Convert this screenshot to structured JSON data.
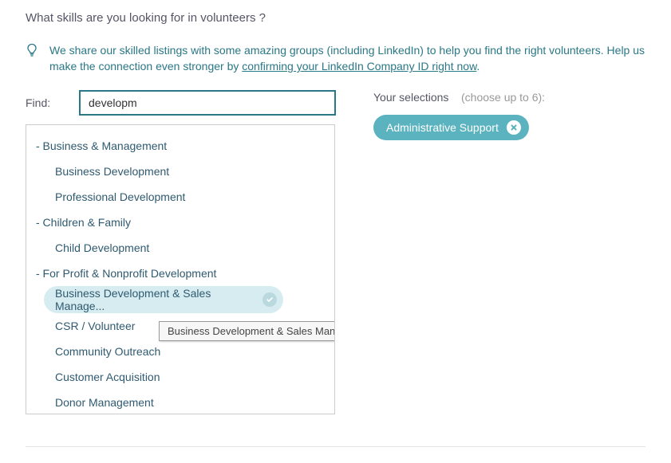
{
  "question": "What skills are you looking for in volunteers ?",
  "info": {
    "pre": "We share our skilled listings with some amazing groups (including LinkedIn) to help you find the right volunteers. Help us make the connection even stronger by ",
    "link": "confirming your LinkedIn Company ID right now",
    "post": "."
  },
  "find_label": "Find:",
  "find_value": "developm",
  "categories": [
    {
      "label": "- Business & Management",
      "items": [
        "Business Development",
        "Professional Development"
      ]
    },
    {
      "label": "- Children & Family",
      "items": [
        "Child Development"
      ]
    },
    {
      "label": "- For Profit & Nonprofit Development",
      "items": [
        "Business Development & Sales Manage...",
        "CSR / Volunteer Coordination",
        "Community Outreach",
        "Customer Acquisition",
        "Donor Management"
      ]
    }
  ],
  "hovered_item_full": "Business Development & Sales Management",
  "selections_label": "Your selections",
  "selections_hint": "(choose up to 6):",
  "selections": [
    {
      "label": "Administrative Support"
    }
  ]
}
